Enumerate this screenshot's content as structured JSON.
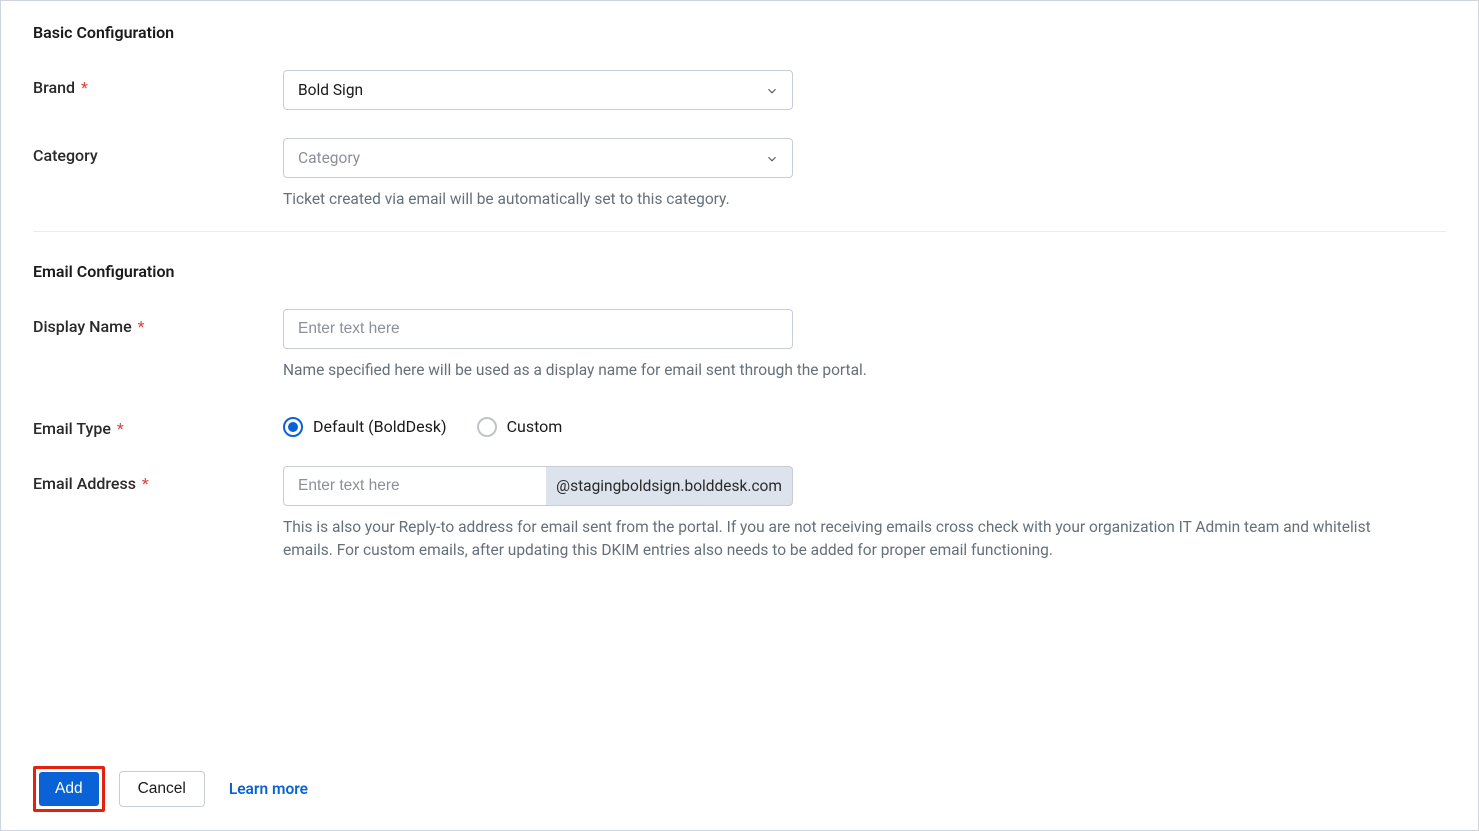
{
  "sections": {
    "basic": {
      "title": "Basic Configuration",
      "brand": {
        "label": "Brand",
        "value": "Bold Sign"
      },
      "category": {
        "label": "Category",
        "placeholder": "Category",
        "help": "Ticket created via email will be automatically set to this category."
      }
    },
    "email": {
      "title": "Email Configuration",
      "display_name": {
        "label": "Display Name",
        "placeholder": "Enter text here",
        "help": "Name specified here will be used as a display name for email sent through the portal."
      },
      "email_type": {
        "label": "Email Type",
        "options": {
          "default": "Default (BoldDesk)",
          "custom": "Custom"
        },
        "selected": "default"
      },
      "email_address": {
        "label": "Email Address",
        "placeholder": "Enter text here",
        "suffix": "@stagingboldsign.bolddesk.com",
        "help": "This is also your Reply-to address for email sent from the portal. If you are not receiving emails cross check with your organization IT Admin team and whitelist emails. For custom emails, after updating this DKIM entries also needs to be added for proper email functioning."
      }
    }
  },
  "footer": {
    "add": "Add",
    "cancel": "Cancel",
    "learn_more": "Learn more"
  },
  "required_mark": "*"
}
